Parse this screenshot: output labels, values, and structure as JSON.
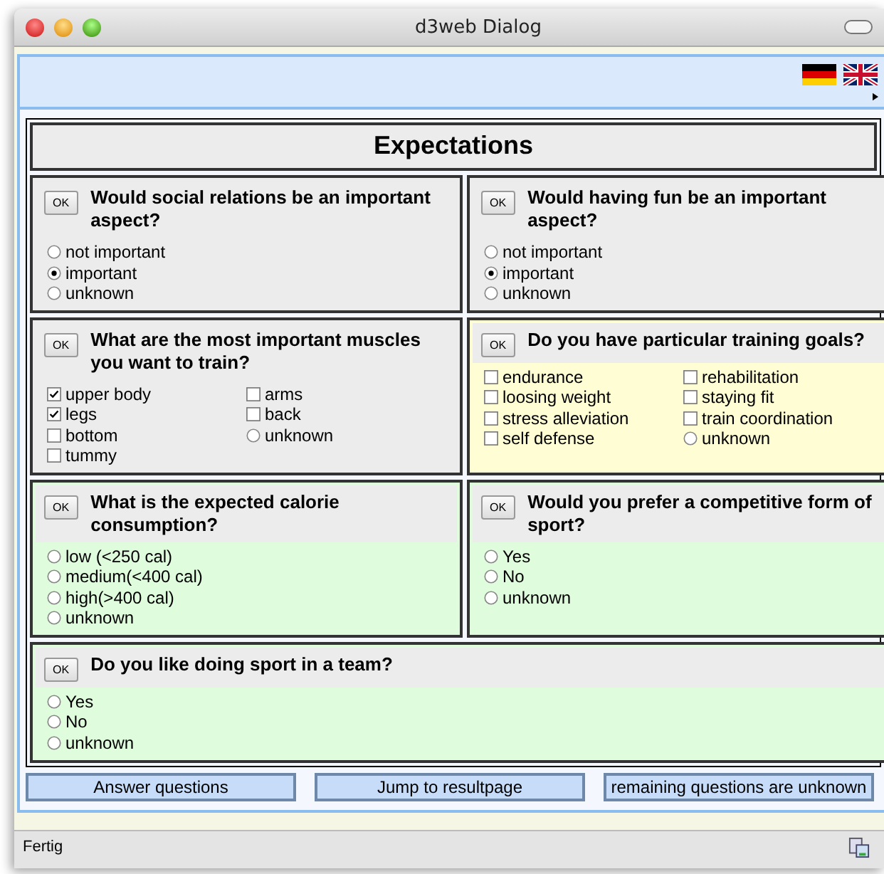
{
  "window": {
    "title": "d3web Dialog"
  },
  "language_flags": [
    {
      "kind": "german"
    },
    {
      "kind": "british"
    }
  ],
  "page_title": "Expectations",
  "questions": [
    {
      "ok": "OK",
      "text": "Would social relations be an important aspect?",
      "color": "#ececec",
      "wide": false,
      "option_columns": [
        [
          {
            "kind": "radio",
            "label": "not important",
            "checked": false
          },
          {
            "kind": "radio",
            "label": "important",
            "checked": true
          },
          {
            "kind": "radio",
            "label": "unknown",
            "checked": false
          }
        ]
      ]
    },
    {
      "ok": "OK",
      "text": "Would having fun be an important aspect?",
      "color": "#ececec",
      "wide": false,
      "option_columns": [
        [
          {
            "kind": "radio",
            "label": "not important",
            "checked": false
          },
          {
            "kind": "radio",
            "label": "important",
            "checked": true
          },
          {
            "kind": "radio",
            "label": "unknown",
            "checked": false
          }
        ]
      ]
    },
    {
      "ok": "OK",
      "text": "What are the most important muscles you want to train?",
      "color": "#ececec",
      "wide": false,
      "option_columns": [
        [
          {
            "kind": "checkbox",
            "label": "upper body",
            "checked": true
          },
          {
            "kind": "checkbox",
            "label": "legs",
            "checked": true
          },
          {
            "kind": "checkbox",
            "label": "bottom",
            "checked": false
          },
          {
            "kind": "checkbox",
            "label": "tummy",
            "checked": false
          }
        ],
        [
          {
            "kind": "checkbox",
            "label": "arms",
            "checked": false
          },
          {
            "kind": "checkbox",
            "label": "back",
            "checked": false
          },
          {
            "kind": "radio",
            "label": "unknown",
            "checked": false
          }
        ]
      ]
    },
    {
      "ok": "OK",
      "text": "Do you have particular training goals?",
      "color": "#fffdd3",
      "wide": false,
      "option_columns": [
        [
          {
            "kind": "checkbox",
            "label": "endurance",
            "checked": false
          },
          {
            "kind": "checkbox",
            "label": "loosing weight",
            "checked": false
          },
          {
            "kind": "checkbox",
            "label": "stress alleviation",
            "checked": false
          },
          {
            "kind": "checkbox",
            "label": "self defense",
            "checked": false
          }
        ],
        [
          {
            "kind": "checkbox",
            "label": "rehabilitation",
            "checked": false
          },
          {
            "kind": "checkbox",
            "label": "staying fit",
            "checked": false
          },
          {
            "kind": "checkbox",
            "label": "train coordination",
            "checked": false
          },
          {
            "kind": "radio",
            "label": "unknown",
            "checked": false
          }
        ]
      ]
    },
    {
      "ok": "OK",
      "text": "What is the expected calorie consumption?",
      "color": "#dffcdc",
      "wide": false,
      "option_columns": [
        [
          {
            "kind": "radio",
            "label": "low (<250 cal)",
            "checked": false
          },
          {
            "kind": "radio",
            "label": "medium(<400 cal)",
            "checked": false
          },
          {
            "kind": "radio",
            "label": "high(>400 cal)",
            "checked": false
          },
          {
            "kind": "radio",
            "label": "unknown",
            "checked": false
          }
        ]
      ]
    },
    {
      "ok": "OK",
      "text": "Would you prefer a competitive form of sport?",
      "color": "#dffcdc",
      "wide": false,
      "option_columns": [
        [
          {
            "kind": "radio",
            "label": "Yes",
            "checked": false
          },
          {
            "kind": "radio",
            "label": "No",
            "checked": false
          },
          {
            "kind": "radio",
            "label": "unknown",
            "checked": false
          }
        ]
      ]
    },
    {
      "ok": "OK",
      "text": "Do you like doing sport in a team?",
      "color": "#dffcdc",
      "wide": true,
      "option_columns": [
        [
          {
            "kind": "radio",
            "label": "Yes",
            "checked": false
          },
          {
            "kind": "radio",
            "label": "No",
            "checked": false
          },
          {
            "kind": "radio",
            "label": "unknown",
            "checked": false
          }
        ]
      ]
    }
  ],
  "buttons": [
    "Answer questions",
    "Jump to resultpage",
    "remaining questions are unknown"
  ],
  "status_bar": {
    "text": "Fertig"
  }
}
